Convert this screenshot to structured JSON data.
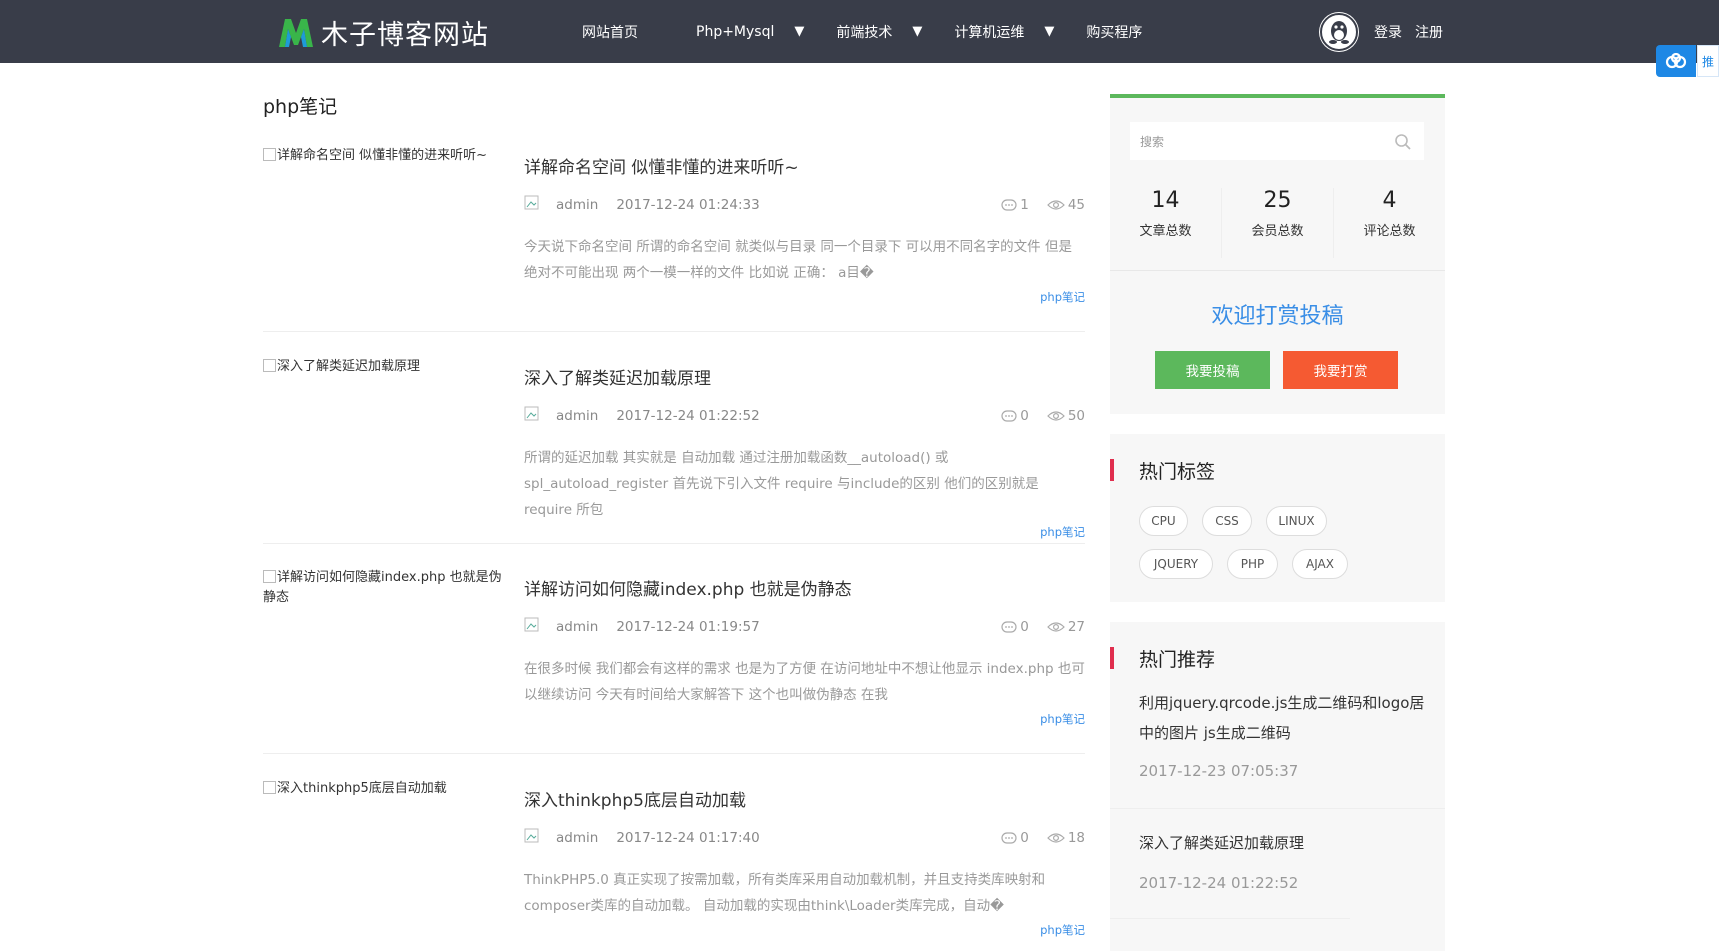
{
  "header": {
    "logo_text": "木子博客网站",
    "nav": [
      {
        "label": "网站首页",
        "has_dropdown": false
      },
      {
        "label": "Php+Mysql",
        "has_dropdown": true
      },
      {
        "label": "前端技术",
        "has_dropdown": true
      },
      {
        "label": "计算机运维",
        "has_dropdown": true
      },
      {
        "label": "购买程序",
        "has_dropdown": false
      }
    ],
    "caret": "▼",
    "login": "登录",
    "register": "注册",
    "side_float_text": "推"
  },
  "page_title": "php笔记",
  "articles": [
    {
      "thumb_alt": "详解命名空间 似懂非懂的进来听听~",
      "title": "详解命名空间 似懂非懂的进来听听~",
      "author": "admin",
      "date": "2017-12-24 01:24:33",
      "comments": "1",
      "views": "45",
      "excerpt": "今天说下命名空间 所谓的命名空间 就类似与目录 同一个目录下 可以用不同名字的文件 但是绝对不可能出现 两个一模一样的文件 比如说 正确： a目�",
      "tag": "php笔记"
    },
    {
      "thumb_alt": "深入了解类延迟加载原理",
      "title": "深入了解类延迟加载原理",
      "author": "admin",
      "date": "2017-12-24 01:22:52",
      "comments": "0",
      "views": "50",
      "excerpt": "所谓的延迟加载 其实就是 自动加载 通过注册加载函数__autoload() 或 spl_autoload_register 首先说下引入文件 require 与include的区别 他们的区别就是 require 所包",
      "tag": "php笔记"
    },
    {
      "thumb_alt": "详解访问如何隐藏index.php 也就是伪静态",
      "title": "详解访问如何隐藏index.php 也就是伪静态",
      "author": "admin",
      "date": "2017-12-24 01:19:57",
      "comments": "0",
      "views": "27",
      "excerpt": "在很多时候 我们都会有这样的需求 也是为了方便 在访问地址中不想让他显示 index.php 也可以继续访问 今天有时间给大家解答下 这个也叫做伪静态 在我",
      "tag": "php笔记"
    },
    {
      "thumb_alt": "深入thinkphp5底层自动加载",
      "title": "深入thinkphp5底层自动加载",
      "author": "admin",
      "date": "2017-12-24 01:17:40",
      "comments": "0",
      "views": "18",
      "excerpt": "ThinkPHP5.0 真正实现了按需加载，所有类库采用自动加载机制，并且支持类库映射和composer类库的自动加载。 自动加载的实现由think\\Loader类库完成，自动�",
      "tag": "php笔记"
    }
  ],
  "sidebar": {
    "search_placeholder": "搜索",
    "stats": [
      {
        "num": "14",
        "label": "文章总数"
      },
      {
        "num": "25",
        "label": "会员总数"
      },
      {
        "num": "4",
        "label": "评论总数"
      }
    ],
    "welcome": "欢迎打赏投稿",
    "btn_submit": "我要投稿",
    "btn_reward": "我要打赏",
    "tags_title": "热门标签",
    "tags": [
      "CPU",
      "CSS",
      "LINUX",
      "JQUERY",
      "PHP",
      "AJAX"
    ],
    "hot_title": "热门推荐",
    "hot": [
      {
        "title": "利用jquery.qrcode.js生成二维码和logo居中的图片 js生成二维码",
        "date": "2017-12-23 07:05:37"
      },
      {
        "title": "深入了解类延迟加载原理",
        "date": "2017-12-24 01:22:52"
      }
    ]
  },
  "colors": {
    "topbar": "#393d49",
    "accent_blue": "#3a8ee6",
    "green": "#5cb85c",
    "orange": "#f55a32",
    "tag_bar": "#e02e4e"
  }
}
